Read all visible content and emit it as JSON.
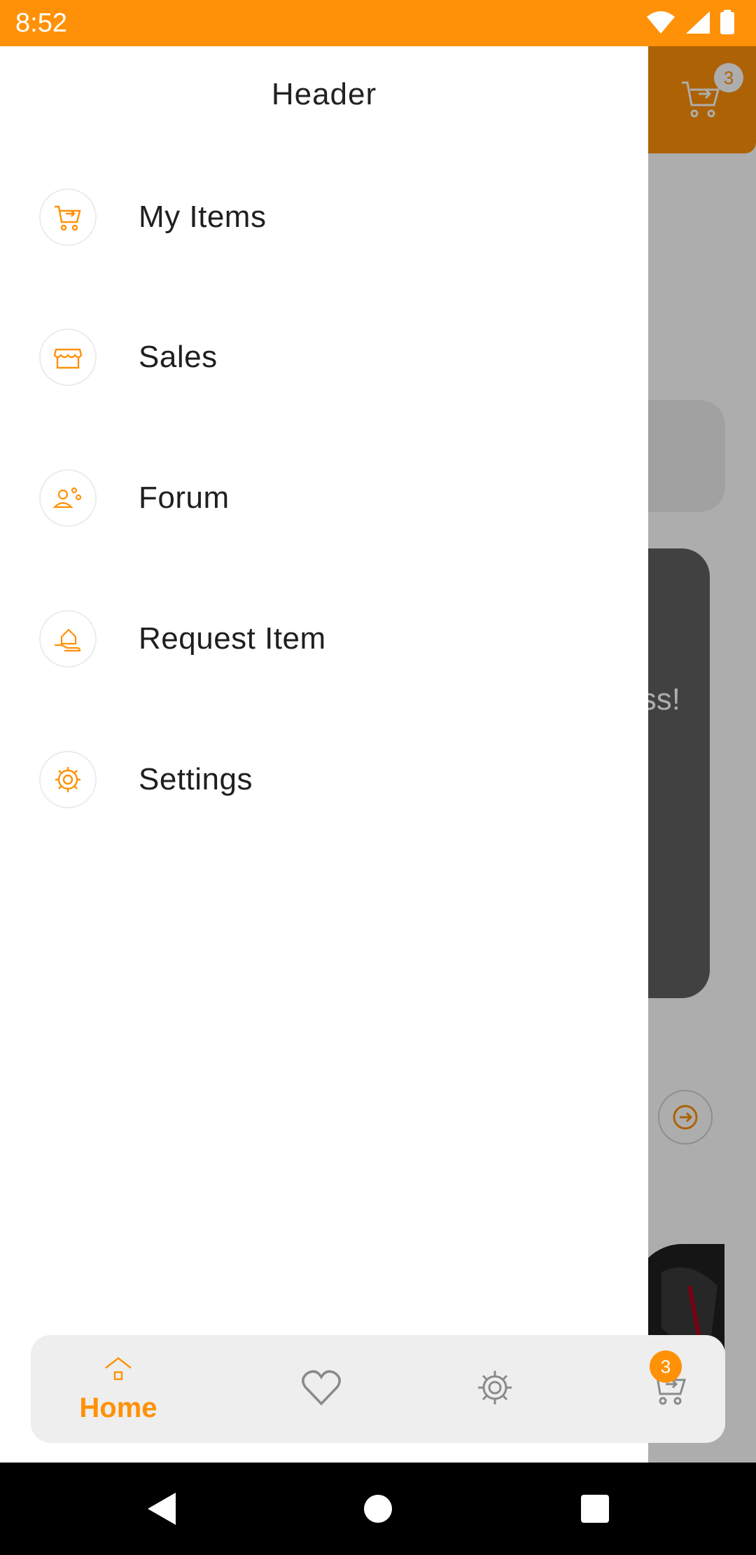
{
  "status_bar": {
    "time": "8:52",
    "icons": [
      "wifi-icon",
      "signal-icon",
      "battery-icon"
    ]
  },
  "background": {
    "cart_badge": "3",
    "promo_text_fragment": "ss!"
  },
  "drawer": {
    "header": "Header",
    "items": [
      {
        "label": "My Items",
        "icon": "cart-icon"
      },
      {
        "label": "Sales",
        "icon": "store-icon"
      },
      {
        "label": "Forum",
        "icon": "forum-icon"
      },
      {
        "label": "Request Item",
        "icon": "request-item-icon"
      },
      {
        "label": "Settings",
        "icon": "gear-icon"
      }
    ]
  },
  "bottom_nav": {
    "home_label": "Home",
    "cart_badge": "3",
    "items": [
      "home-icon",
      "heart-icon",
      "gear-icon",
      "cart-icon"
    ]
  },
  "colors": {
    "accent": "#FF9108",
    "drawer_bg": "#FFFFFF",
    "nav_bg": "#EEEEEE"
  }
}
